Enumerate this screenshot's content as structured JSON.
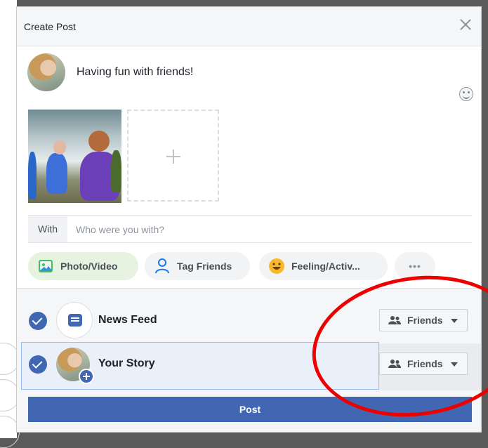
{
  "dialog": {
    "title": "Create Post",
    "close_icon": "close-icon"
  },
  "composer": {
    "text": "Having fun with friends!",
    "emoji_icon": "smiley-icon"
  },
  "attachments": {
    "photo_alt": "children playing in the snow",
    "add_icon": "plus-icon"
  },
  "with_row": {
    "label": "With",
    "placeholder": "Who were you with?"
  },
  "actions": [
    {
      "label": "Photo/Video",
      "icon": "photo-icon"
    },
    {
      "label": "Tag Friends",
      "icon": "tag-person-icon"
    },
    {
      "label": "Feeling/Activ...",
      "icon": "smiley-icon"
    },
    {
      "label": "•••",
      "icon": "more-icon"
    }
  ],
  "share_options": [
    {
      "label": "News Feed",
      "checked": true,
      "audience": "Friends",
      "icon": "news-feed-icon"
    },
    {
      "label": "Your Story",
      "checked": true,
      "audience": "Friends",
      "icon": "story-avatar"
    }
  ],
  "post_button": "Post",
  "colors": {
    "accent": "#4267b2",
    "header_bg": "#f5f6f7",
    "annotation": "#ee0000"
  }
}
